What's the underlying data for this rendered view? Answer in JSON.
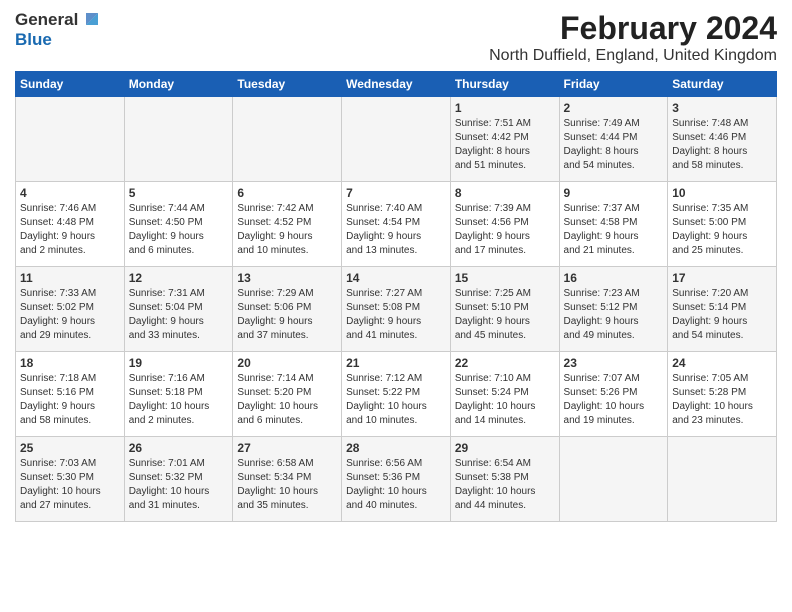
{
  "header": {
    "logo_general": "General",
    "logo_blue": "Blue",
    "month_year": "February 2024",
    "location": "North Duffield, England, United Kingdom"
  },
  "days_of_week": [
    "Sunday",
    "Monday",
    "Tuesday",
    "Wednesday",
    "Thursday",
    "Friday",
    "Saturday"
  ],
  "weeks": [
    [
      {
        "day": "",
        "info": ""
      },
      {
        "day": "",
        "info": ""
      },
      {
        "day": "",
        "info": ""
      },
      {
        "day": "",
        "info": ""
      },
      {
        "day": "1",
        "info": "Sunrise: 7:51 AM\nSunset: 4:42 PM\nDaylight: 8 hours\nand 51 minutes."
      },
      {
        "day": "2",
        "info": "Sunrise: 7:49 AM\nSunset: 4:44 PM\nDaylight: 8 hours\nand 54 minutes."
      },
      {
        "day": "3",
        "info": "Sunrise: 7:48 AM\nSunset: 4:46 PM\nDaylight: 8 hours\nand 58 minutes."
      }
    ],
    [
      {
        "day": "4",
        "info": "Sunrise: 7:46 AM\nSunset: 4:48 PM\nDaylight: 9 hours\nand 2 minutes."
      },
      {
        "day": "5",
        "info": "Sunrise: 7:44 AM\nSunset: 4:50 PM\nDaylight: 9 hours\nand 6 minutes."
      },
      {
        "day": "6",
        "info": "Sunrise: 7:42 AM\nSunset: 4:52 PM\nDaylight: 9 hours\nand 10 minutes."
      },
      {
        "day": "7",
        "info": "Sunrise: 7:40 AM\nSunset: 4:54 PM\nDaylight: 9 hours\nand 13 minutes."
      },
      {
        "day": "8",
        "info": "Sunrise: 7:39 AM\nSunset: 4:56 PM\nDaylight: 9 hours\nand 17 minutes."
      },
      {
        "day": "9",
        "info": "Sunrise: 7:37 AM\nSunset: 4:58 PM\nDaylight: 9 hours\nand 21 minutes."
      },
      {
        "day": "10",
        "info": "Sunrise: 7:35 AM\nSunset: 5:00 PM\nDaylight: 9 hours\nand 25 minutes."
      }
    ],
    [
      {
        "day": "11",
        "info": "Sunrise: 7:33 AM\nSunset: 5:02 PM\nDaylight: 9 hours\nand 29 minutes."
      },
      {
        "day": "12",
        "info": "Sunrise: 7:31 AM\nSunset: 5:04 PM\nDaylight: 9 hours\nand 33 minutes."
      },
      {
        "day": "13",
        "info": "Sunrise: 7:29 AM\nSunset: 5:06 PM\nDaylight: 9 hours\nand 37 minutes."
      },
      {
        "day": "14",
        "info": "Sunrise: 7:27 AM\nSunset: 5:08 PM\nDaylight: 9 hours\nand 41 minutes."
      },
      {
        "day": "15",
        "info": "Sunrise: 7:25 AM\nSunset: 5:10 PM\nDaylight: 9 hours\nand 45 minutes."
      },
      {
        "day": "16",
        "info": "Sunrise: 7:23 AM\nSunset: 5:12 PM\nDaylight: 9 hours\nand 49 minutes."
      },
      {
        "day": "17",
        "info": "Sunrise: 7:20 AM\nSunset: 5:14 PM\nDaylight: 9 hours\nand 54 minutes."
      }
    ],
    [
      {
        "day": "18",
        "info": "Sunrise: 7:18 AM\nSunset: 5:16 PM\nDaylight: 9 hours\nand 58 minutes."
      },
      {
        "day": "19",
        "info": "Sunrise: 7:16 AM\nSunset: 5:18 PM\nDaylight: 10 hours\nand 2 minutes."
      },
      {
        "day": "20",
        "info": "Sunrise: 7:14 AM\nSunset: 5:20 PM\nDaylight: 10 hours\nand 6 minutes."
      },
      {
        "day": "21",
        "info": "Sunrise: 7:12 AM\nSunset: 5:22 PM\nDaylight: 10 hours\nand 10 minutes."
      },
      {
        "day": "22",
        "info": "Sunrise: 7:10 AM\nSunset: 5:24 PM\nDaylight: 10 hours\nand 14 minutes."
      },
      {
        "day": "23",
        "info": "Sunrise: 7:07 AM\nSunset: 5:26 PM\nDaylight: 10 hours\nand 19 minutes."
      },
      {
        "day": "24",
        "info": "Sunrise: 7:05 AM\nSunset: 5:28 PM\nDaylight: 10 hours\nand 23 minutes."
      }
    ],
    [
      {
        "day": "25",
        "info": "Sunrise: 7:03 AM\nSunset: 5:30 PM\nDaylight: 10 hours\nand 27 minutes."
      },
      {
        "day": "26",
        "info": "Sunrise: 7:01 AM\nSunset: 5:32 PM\nDaylight: 10 hours\nand 31 minutes."
      },
      {
        "day": "27",
        "info": "Sunrise: 6:58 AM\nSunset: 5:34 PM\nDaylight: 10 hours\nand 35 minutes."
      },
      {
        "day": "28",
        "info": "Sunrise: 6:56 AM\nSunset: 5:36 PM\nDaylight: 10 hours\nand 40 minutes."
      },
      {
        "day": "29",
        "info": "Sunrise: 6:54 AM\nSunset: 5:38 PM\nDaylight: 10 hours\nand 44 minutes."
      },
      {
        "day": "",
        "info": ""
      },
      {
        "day": "",
        "info": ""
      }
    ]
  ]
}
